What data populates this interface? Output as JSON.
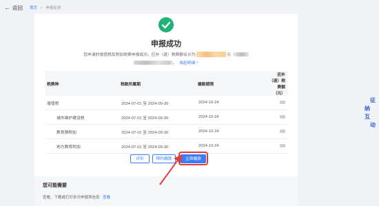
{
  "topbar": {
    "back_label": "返回",
    "breadcrumb": [
      "首页",
      "申报反馈"
    ]
  },
  "result": {
    "title": "申报成功",
    "line1_prefix": "您申请的增值税及附加税费申报成功，应补（退）税费额合计为",
    "line1_unit": "元（",
    "line2_suffix": "）。",
    "toggle_link": "收起明细 ^"
  },
  "table": {
    "headers": [
      "税费种",
      "税款所属期",
      "缴款期限",
      "应补（退）税费额（元）"
    ],
    "rows": [
      {
        "type": "增值税",
        "period": "2024-07-01 至 2024-09-30",
        "deadline": "2024-10-24"
      },
      {
        "type": "城市维护建设税",
        "period": "2024-07-01 至 2024-09-30",
        "deadline": "2024-10-24"
      },
      {
        "type": "教育费附加",
        "period": "2024-07-01 至 2024-09-30",
        "deadline": "2024-10-24"
      },
      {
        "type": "地方教育附加",
        "period": "2024-07-01 至 2024-09-30",
        "deadline": "2024-10-24"
      }
    ]
  },
  "actions": {
    "evaluate": "评价",
    "appointment": "预约缴款",
    "pay_now": "立即缴款"
  },
  "maybe": {
    "title": "您可能需要",
    "text": "查看、下载或打印本次申报表信息",
    "link": "查看"
  },
  "side_widget": {
    "chars": [
      "征",
      "纳",
      "互",
      "动"
    ]
  },
  "colors": {
    "accent": "#3d7cf3",
    "success": "#1fb37a",
    "highlight": "#e23b3b"
  }
}
